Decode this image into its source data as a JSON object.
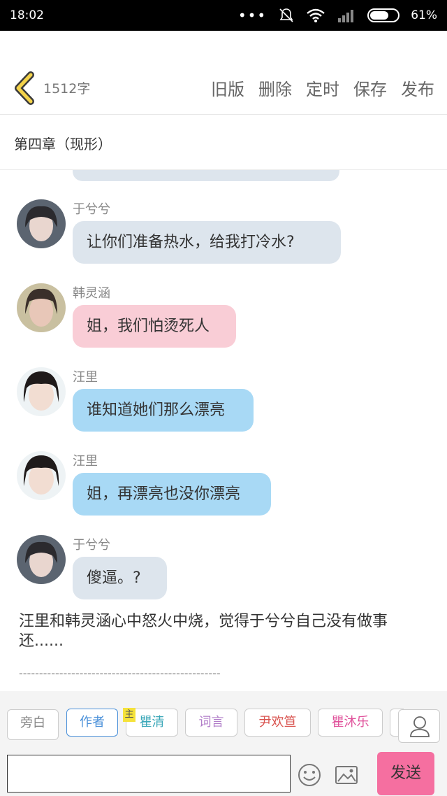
{
  "status_bar": {
    "time": "18:02",
    "battery": "61%"
  },
  "header": {
    "word_count": "1512字",
    "actions": [
      "旧版",
      "删除",
      "定时",
      "保存",
      "发布"
    ]
  },
  "chapter_title": "第四章（现形）",
  "messages": [
    {
      "name": "于兮兮",
      "text": "让你们准备热水，给我打冷水?",
      "color": "#dde5ed"
    },
    {
      "name": "韩灵涵",
      "text": "姐，我们怕烫死人",
      "color": "#f9cdd6"
    },
    {
      "name": "汪里",
      "text": "谁知道她们那么漂亮",
      "color": "#a8d9f5"
    },
    {
      "name": "汪里",
      "text": "姐，再漂亮也没你漂亮",
      "color": "#a8d9f5"
    },
    {
      "name": "于兮兮",
      "text": "傻逼。?",
      "color": "#dde5ed"
    }
  ],
  "narration": "汪里和韩灵涵心中怒火中烧，觉得于兮兮自己没有做事还......",
  "divider": "--------------------------------------------------",
  "roles": [
    {
      "label": "旁白",
      "color": "#888888"
    },
    {
      "label": "作者",
      "color": "#4a90d9"
    },
    {
      "label": "瞿清",
      "color": "#3aa7b8"
    },
    {
      "label": "词言",
      "color": "#b07cc8"
    },
    {
      "label": "尹欢笪",
      "color": "#d9534f"
    },
    {
      "label": "瞿沐乐",
      "color": "#e0529b"
    }
  ],
  "main_badge": "主",
  "send_label": "发送",
  "icons": {
    "back": "chevron-left-icon",
    "emoji": "smiley-icon",
    "image": "image-icon",
    "user": "user-icon"
  }
}
